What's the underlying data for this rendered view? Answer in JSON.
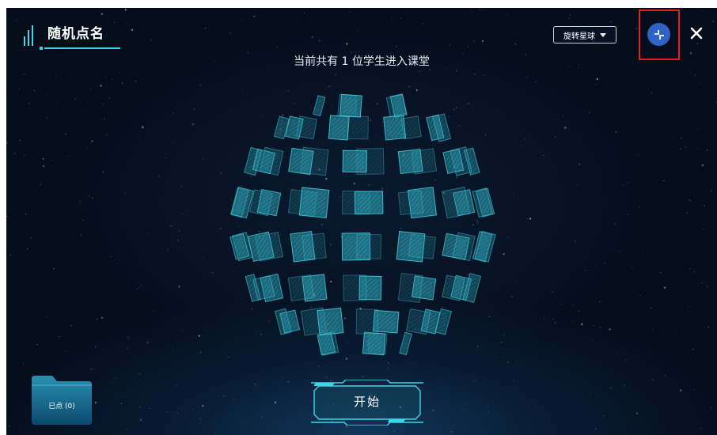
{
  "app": {
    "title": "随机点名",
    "subtitle": "当前共有 1 位学生进入课堂"
  },
  "toolbar": {
    "mode_select": {
      "selected": "旋转星球",
      "icon": "caret-down-icon"
    },
    "fullscreen_icon": "compress-arrows-icon",
    "close_icon": "close-icon"
  },
  "picked_folder": {
    "label": "已点 (0)",
    "icon": "folder-icon"
  },
  "start_button": {
    "label": "开始"
  },
  "colors": {
    "accent": "#3bd7e8",
    "background": "#040a16",
    "fullscreen_button": "#2f63c8",
    "highlight": "#e02020"
  }
}
